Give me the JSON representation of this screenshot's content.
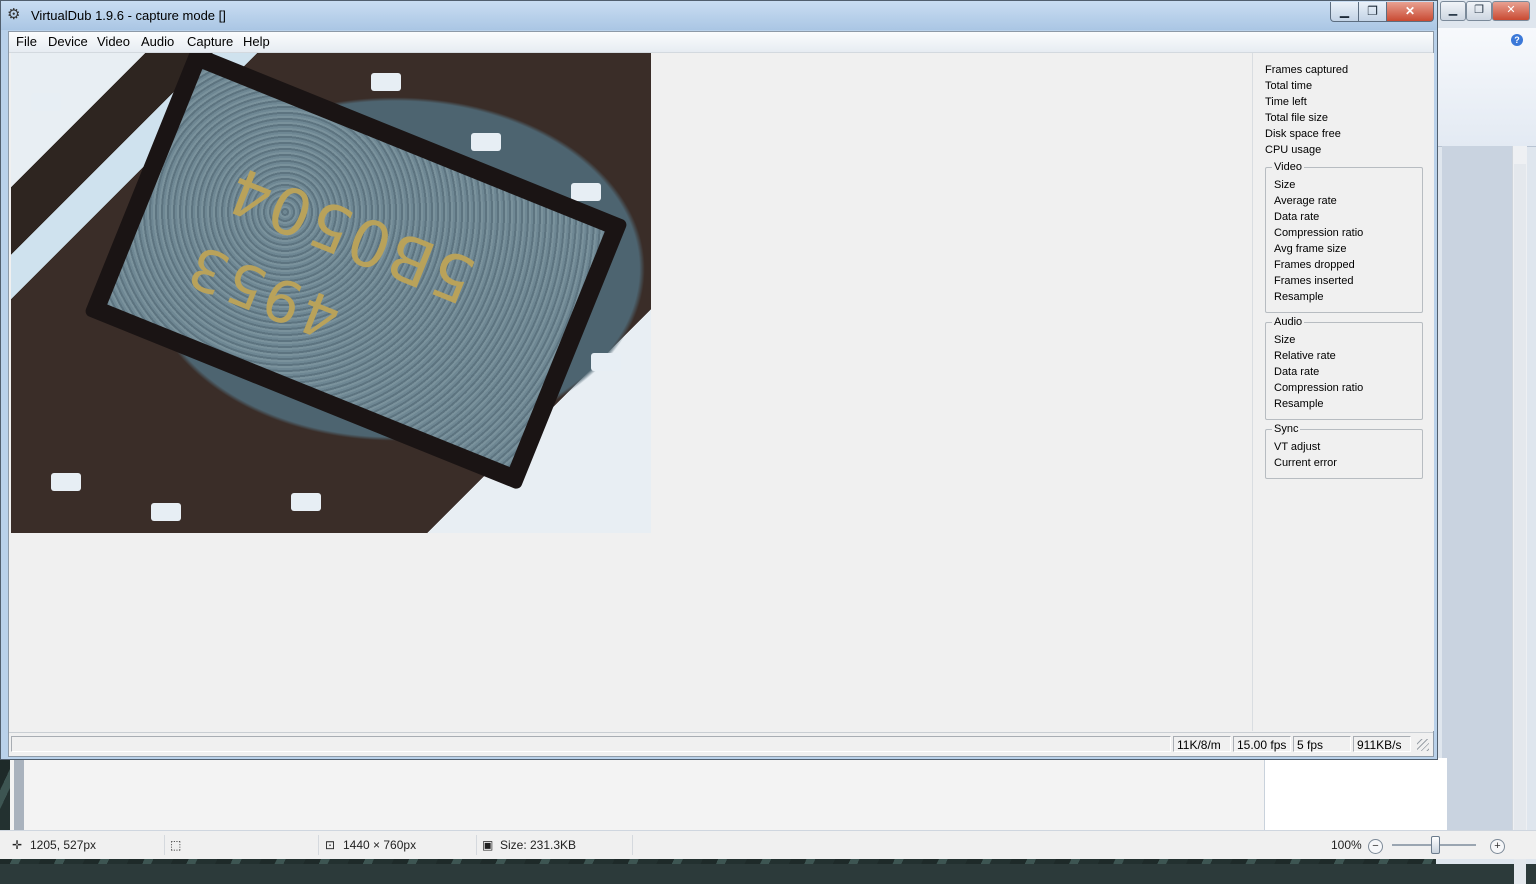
{
  "virtualdub": {
    "title": "VirtualDub 1.9.6 - capture mode []",
    "caption_buttons": {
      "minimize": "▁",
      "maximize": "❐",
      "close": "✕"
    },
    "menu": [
      "File",
      "Device",
      "Video",
      "Audio",
      "Capture",
      "Help"
    ],
    "preview": {
      "chip_marking_line1": "5B0504",
      "chip_marking_line2": "4953"
    },
    "stats": {
      "top": [
        "Frames captured",
        "Total time",
        "Time left",
        "Total file size",
        "Disk space free",
        "CPU usage"
      ],
      "video": {
        "title": "Video",
        "items": [
          "Size",
          "Average rate",
          "Data rate",
          "Compression ratio",
          "Avg frame size",
          "Frames dropped",
          "Frames inserted",
          "Resample"
        ]
      },
      "audio": {
        "title": "Audio",
        "items": [
          "Size",
          "Relative rate",
          "Data rate",
          "Compression ratio",
          "Resample"
        ]
      },
      "sync": {
        "title": "Sync",
        "items": [
          "VT adjust",
          "Current error"
        ]
      }
    },
    "status_bar": [
      "11K/8/m",
      "15.00 fps",
      "5 fps",
      "911KB/s"
    ]
  },
  "paint": {
    "caption_buttons": {
      "minimize": "▁",
      "maximize": "❐",
      "close": "✕"
    },
    "help_icon": "?",
    "status": {
      "cursor_pos": "1205, 527px",
      "dimensions": "1440 × 760px",
      "size": "Size: 231.3KB",
      "zoom": "100%",
      "zoom_out": "−",
      "zoom_in": "+"
    }
  },
  "icons": [
    "app-icon",
    "cursor-icon",
    "selection-icon",
    "dimensions-icon",
    "disk-icon",
    "zoom-out-icon",
    "zoom-in-icon",
    "help-icon",
    "resize-grip-icon"
  ]
}
